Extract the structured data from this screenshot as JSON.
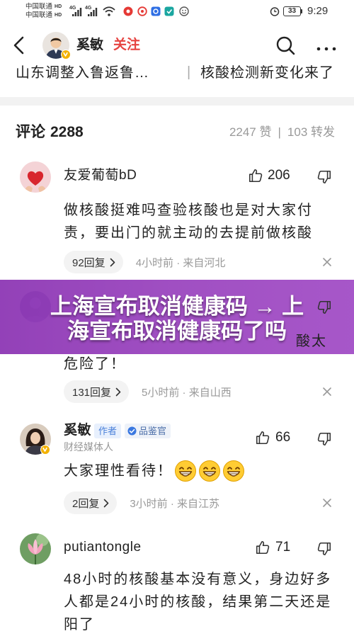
{
  "status_bar": {
    "carrier_1": "中国联通",
    "carrier_1_tag": "HD",
    "carrier_2": "中国联通",
    "carrier_2_tag": "HD",
    "network_1": "4G",
    "network_2": "4G",
    "notification_icons": [
      "red-app-icon",
      "red-ring-icon",
      "blue-app-icon",
      "teal-app-icon",
      "smiley-icon"
    ],
    "battery": "33",
    "time": "9:29"
  },
  "header": {
    "author_name": "奚敏",
    "follow_label": "关注",
    "icons": [
      "back-arrow-icon",
      "search-icon",
      "more-icon"
    ]
  },
  "tabs": [
    {
      "label": "山东调整入鲁返鲁…"
    },
    {
      "label": "核酸检测新变化来了"
    }
  ],
  "tabs_divider": "|",
  "comments_header": {
    "title": "评论",
    "count": "2288",
    "likes_label": "2247 赞",
    "separator": "|",
    "shares_label": "103 转发"
  },
  "overlay_banner": {
    "lines": [
      "上海宣布取消健康码 → 上",
      "海宣布取消健康码了吗"
    ]
  },
  "comments": [
    {
      "name": "友爱葡萄bD",
      "likes": "206",
      "lines": [
        "做核酸挺难吗查验核酸也是对大家付",
        "责，要出门的就主动的去提前做核酸"
      ],
      "reply_label": "92回复",
      "meta": "4小时前 · 来自河北"
    },
    {
      "partial_line": "酸太",
      "lines": [
        "危险了！"
      ],
      "reply_label": "131回复",
      "meta": "5小时前 · 来自山西"
    },
    {
      "name": "奚敏",
      "badges": [
        "作者",
        "品鉴官"
      ],
      "subtitle": "财经媒体人",
      "likes": "66",
      "lines": [
        "大家理性看待！"
      ],
      "emoji": [
        "grin-emoji",
        "grin-emoji",
        "grin-emoji"
      ],
      "reply_label": "2回复",
      "meta": "3小时前 · 来自江苏"
    },
    {
      "name": "putiantongle",
      "likes": "71",
      "lines": [
        "48小时的核酸基本没有意义，身边好多",
        "人都是24小时的核酸，结果第二天还是",
        "阳了"
      ]
    }
  ],
  "colors": {
    "follow_red": "#e64340",
    "banner_purple": "#9b46bf",
    "badge_blue": "#4a80d9",
    "verified_yellow": "#f3b200",
    "meta_gray": "#999999"
  }
}
